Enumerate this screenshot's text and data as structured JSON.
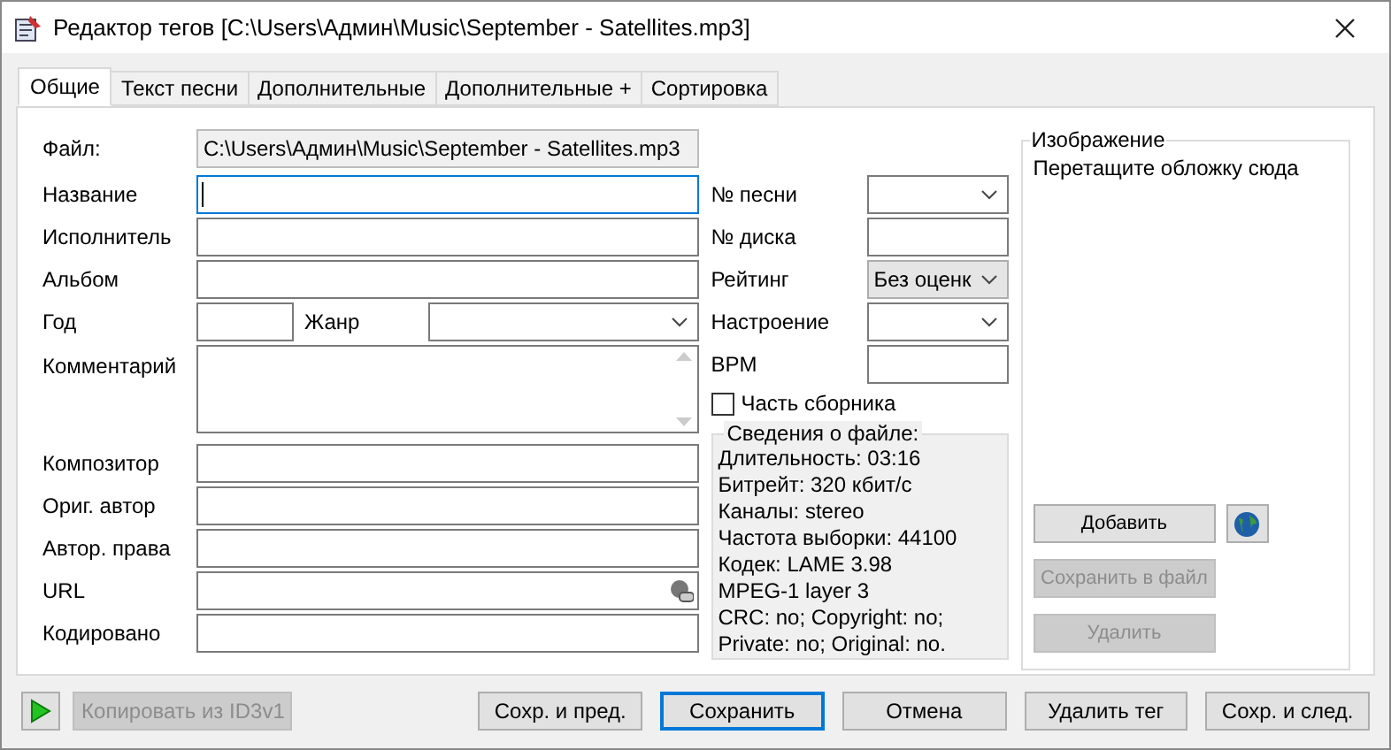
{
  "window": {
    "title": "Редактор тегов [C:\\Users\\Админ\\Music\\September - Satellites.mp3]"
  },
  "tabs": [
    {
      "label": "Общие",
      "selected": true
    },
    {
      "label": "Текст песни",
      "selected": false
    },
    {
      "label": "Дополнительные",
      "selected": false
    },
    {
      "label": "Дополнительные +",
      "selected": false
    },
    {
      "label": "Сортировка",
      "selected": false
    }
  ],
  "file": {
    "label": "Файл:",
    "value": "C:\\Users\\Админ\\Music\\September - Satellites.mp3"
  },
  "left_fields": [
    {
      "kind": "text",
      "label": "Название",
      "focused": true
    },
    {
      "kind": "text",
      "label": "Исполнитель",
      "focused": false
    },
    {
      "kind": "text",
      "label": "Альбом",
      "focused": false
    },
    {
      "kind": "pair",
      "label": "Год",
      "label2": "Жанр",
      "focused": false
    },
    {
      "kind": "memo",
      "label": "Комментарий",
      "focused": false
    },
    {
      "kind": "text",
      "label": "Композитор",
      "focused": false
    },
    {
      "kind": "text",
      "label": "Ориг. автор",
      "focused": false
    },
    {
      "kind": "text",
      "label": "Автор. права",
      "focused": false
    },
    {
      "kind": "url",
      "label": "URL",
      "focused": false
    },
    {
      "kind": "text",
      "label": "Кодировано",
      "focused": false
    }
  ],
  "right_fields": [
    {
      "kind": "combo",
      "label": "№ песни"
    },
    {
      "kind": "text",
      "label": "№ диска"
    },
    {
      "kind": "select",
      "label": "Рейтинг",
      "value": "Без оценк"
    },
    {
      "kind": "combo",
      "label": "Настроение"
    },
    {
      "kind": "text",
      "label": "BPM"
    }
  ],
  "compilation": {
    "label": "Часть сборника",
    "checked": false
  },
  "file_info": {
    "title": "Сведения о файле:",
    "lines": [
      "Длительность: 03:16",
      "Битрейт: 320 кбит/с",
      "Каналы: stereo",
      "Частота выборки: 44100",
      "Кодек: LAME 3.98",
      "MPEG-1 layer 3",
      "CRC: no; Copyright: no;",
      "Private: no; Original: no."
    ]
  },
  "image": {
    "title": "Изображение",
    "hint": "Перетащите обложку сюда",
    "buttons": [
      {
        "label": "Добавить",
        "disabled": false
      },
      {
        "label": "Сохранить в файл",
        "disabled": true
      },
      {
        "label": "Удалить",
        "disabled": true
      }
    ]
  },
  "bottom_buttons": [
    {
      "label": "Копировать из ID3v1",
      "disabled": true,
      "default": false
    },
    {
      "label": "Сохр. и пред.",
      "disabled": false,
      "default": false
    },
    {
      "label": "Сохранить",
      "disabled": false,
      "default": true
    },
    {
      "label": "Отмена",
      "disabled": false,
      "default": false
    },
    {
      "label": "Удалить тег",
      "disabled": false,
      "default": false
    },
    {
      "label": "Сохр. и след.",
      "disabled": false,
      "default": false
    }
  ]
}
